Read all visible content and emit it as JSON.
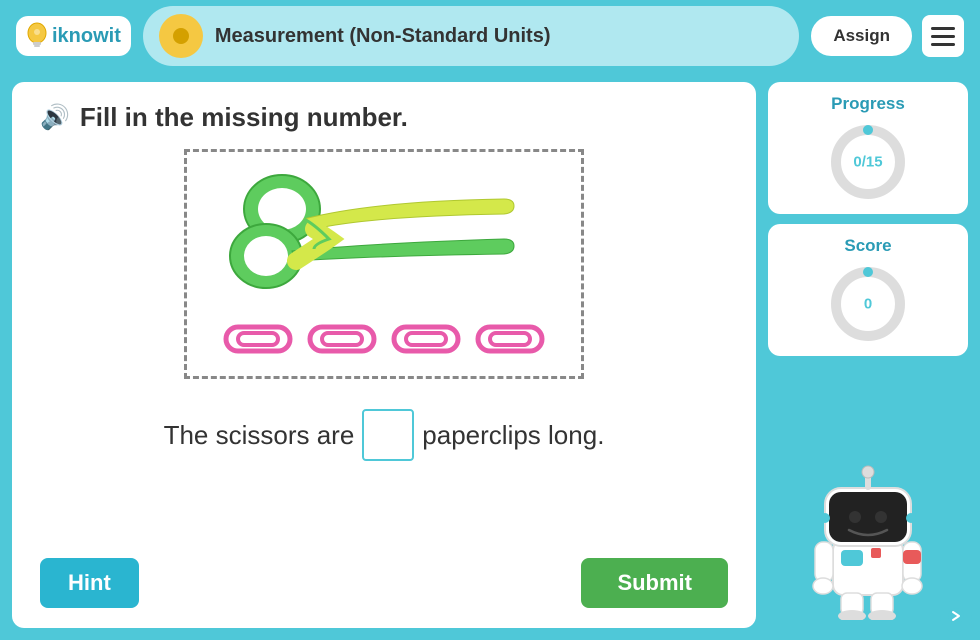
{
  "header": {
    "logo_text": "iknowit",
    "title": "Measurement (Non-Standard Units)",
    "assign_label": "Assign",
    "menu_label": "Menu"
  },
  "question": {
    "instruction": "Fill in the missing number.",
    "sentence_before": "The scissors are",
    "sentence_after": "paperclips long.",
    "answer_placeholder": ""
  },
  "sidebar": {
    "progress_label": "Progress",
    "progress_value": "0/15",
    "score_label": "Score",
    "score_value": "0"
  },
  "buttons": {
    "hint_label": "Hint",
    "submit_label": "Submit"
  },
  "colors": {
    "teal": "#4fc8d8",
    "green": "#4caf50",
    "hint_blue": "#2ab5d0"
  }
}
